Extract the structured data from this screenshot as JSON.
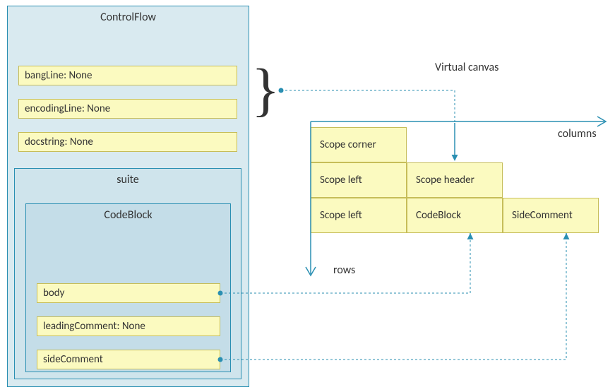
{
  "left": {
    "outer_title": "ControlFlow",
    "fields": {
      "bangLine": "bangLine: None",
      "encodingLine": "encodingLine: None",
      "docstring": "docstring: None"
    },
    "suite_title": "suite",
    "codeblock_title": "CodeBlock",
    "codeblock_fields": {
      "body": "body",
      "leadingComment": "leadingComment: None",
      "sideComment": "sideComment"
    }
  },
  "canvas": {
    "title": "Virtual canvas",
    "columns_label": "columns",
    "rows_label": "rows",
    "cells": {
      "corner": "Scope corner",
      "scope_left": "Scope left",
      "scope_header": "Scope header",
      "code_block": "CodeBlock",
      "side_comment": "SideComment"
    }
  }
}
